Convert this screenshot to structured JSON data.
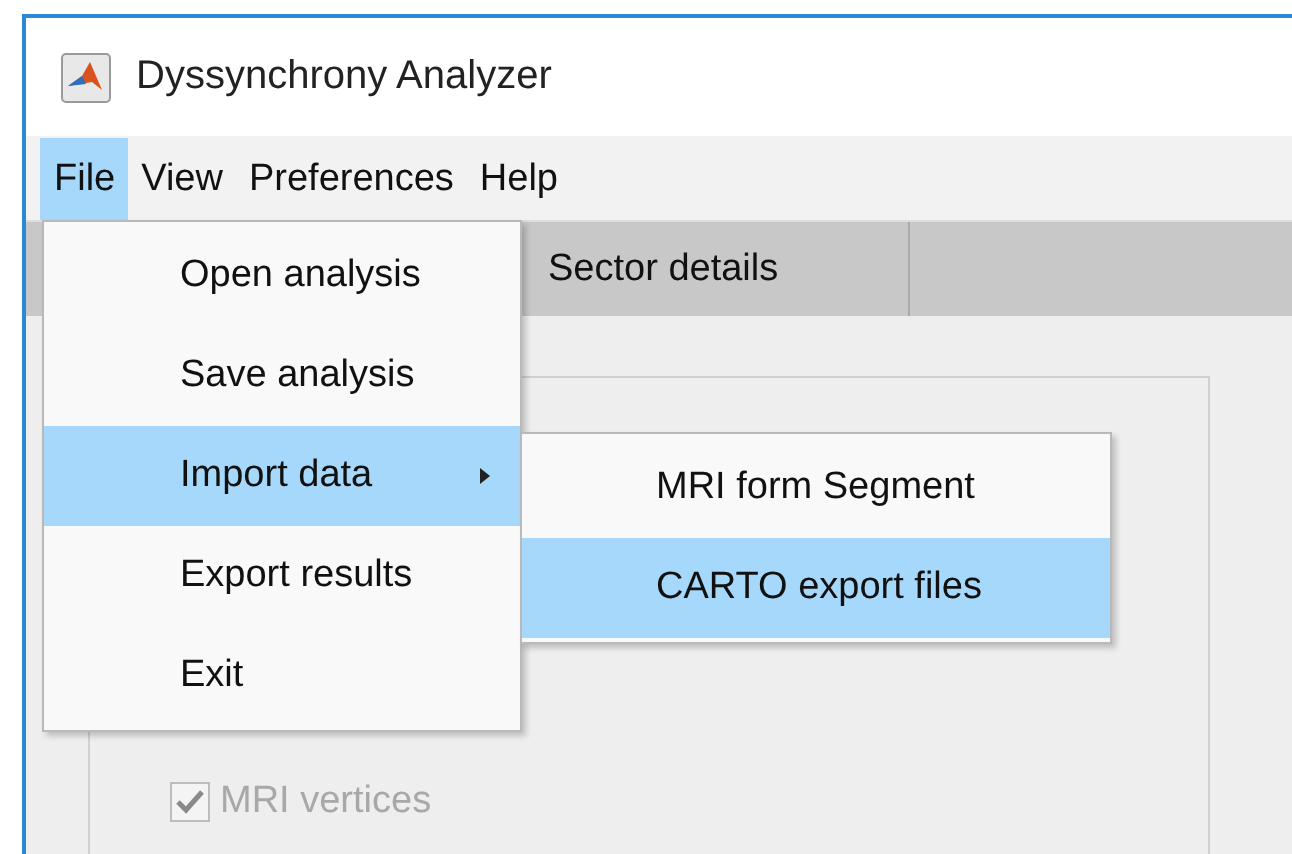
{
  "window": {
    "title": "Dyssynchrony Analyzer"
  },
  "menubar": [
    {
      "label": "File",
      "selected": true
    },
    {
      "label": "View",
      "selected": false
    },
    {
      "label": "Preferences",
      "selected": false
    },
    {
      "label": "Help",
      "selected": false
    }
  ],
  "tabs": [
    {
      "label": "Sector details"
    }
  ],
  "panel": {
    "checkboxes": [
      {
        "label": "MRI vertices",
        "checked": true,
        "disabled": true
      }
    ]
  },
  "file_menu": [
    {
      "label": "Open analysis",
      "selected": false
    },
    {
      "label": "Save analysis",
      "selected": false
    },
    {
      "label": "Import data",
      "selected": true,
      "children": [
        {
          "label": "MRI form Segment",
          "selected": false
        },
        {
          "label": "CARTO export files",
          "selected": true
        }
      ]
    },
    {
      "label": "Export results",
      "selected": false
    },
    {
      "label": "Exit",
      "selected": false
    }
  ]
}
